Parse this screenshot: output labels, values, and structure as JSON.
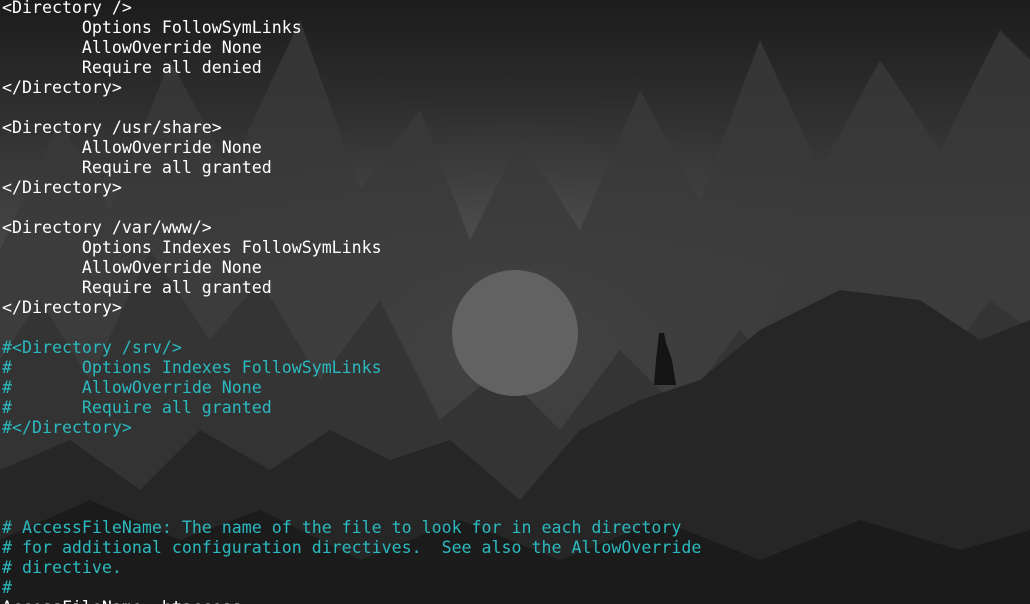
{
  "terminal": {
    "lines": [
      {
        "text": "<Directory />",
        "kind": "code"
      },
      {
        "text": "        Options FollowSymLinks",
        "kind": "code"
      },
      {
        "text": "        AllowOverride None",
        "kind": "code"
      },
      {
        "text": "        Require all denied",
        "kind": "code"
      },
      {
        "text": "</Directory>",
        "kind": "code"
      },
      {
        "text": "",
        "kind": "blank"
      },
      {
        "text": "<Directory /usr/share>",
        "kind": "code"
      },
      {
        "text": "        AllowOverride None",
        "kind": "code"
      },
      {
        "text": "        Require all granted",
        "kind": "code"
      },
      {
        "text": "</Directory>",
        "kind": "code"
      },
      {
        "text": "",
        "kind": "blank"
      },
      {
        "text": "<Directory /var/www/>",
        "kind": "code"
      },
      {
        "text": "        Options Indexes FollowSymLinks",
        "kind": "code"
      },
      {
        "text": "        AllowOverride None",
        "kind": "code"
      },
      {
        "text": "        Require all granted",
        "kind": "code"
      },
      {
        "text": "</Directory>",
        "kind": "code"
      },
      {
        "text": "",
        "kind": "blank"
      },
      {
        "text": "#<Directory /srv/>",
        "kind": "comment"
      },
      {
        "text": "#       Options Indexes FollowSymLinks",
        "kind": "comment"
      },
      {
        "text": "#       AllowOverride None",
        "kind": "comment"
      },
      {
        "text": "#       Require all granted",
        "kind": "comment"
      },
      {
        "text": "#</Directory>",
        "kind": "comment"
      },
      {
        "text": "",
        "kind": "blank"
      },
      {
        "text": "",
        "kind": "blank"
      },
      {
        "text": "",
        "kind": "blank"
      },
      {
        "text": "",
        "kind": "blank"
      },
      {
        "text": "# AccessFileName: The name of the file to look for in each directory",
        "kind": "comment"
      },
      {
        "text": "# for additional configuration directives.  See also the AllowOverride",
        "kind": "comment"
      },
      {
        "text": "# directive.",
        "kind": "comment"
      },
      {
        "text": "#",
        "kind": "comment"
      },
      {
        "text": "AccessFileName .htaccess",
        "kind": "code"
      }
    ]
  },
  "colors": {
    "text": "#ffffff",
    "comment": "#2bb9bf",
    "background": "#2a2a2a"
  },
  "wallpaper": {
    "subject": "misty-mountains-moon-figure"
  }
}
